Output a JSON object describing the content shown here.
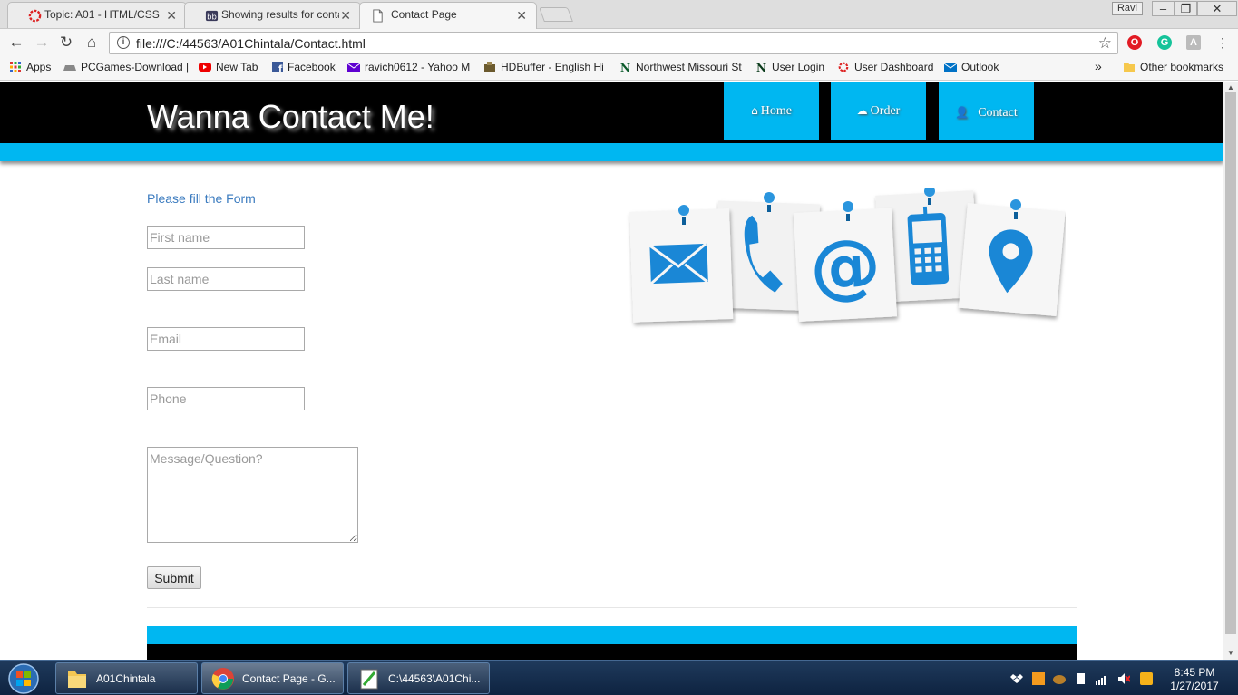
{
  "browser": {
    "tabs": [
      {
        "title": "Topic: A01 - HTML/CSS",
        "icon": "red-ring-icon"
      },
      {
        "title": "Showing results for conta",
        "icon": "blackboard-icon"
      },
      {
        "title": "Contact Page",
        "icon": "document-icon"
      }
    ],
    "profile_label": "Ravi",
    "url": "file:///C:/44563/A01Chintala/Contact.html",
    "bookmarks": [
      {
        "label": "Apps",
        "icon": "apps-grid-icon"
      },
      {
        "label": "PCGames-Download |",
        "icon": "gamepad-icon"
      },
      {
        "label": "New Tab",
        "icon": "youtube-icon"
      },
      {
        "label": "Facebook",
        "icon": "facebook-icon"
      },
      {
        "label": "ravich0612 - Yahoo M",
        "icon": "yahoo-mail-icon"
      },
      {
        "label": "HDBuffer - English Hi",
        "icon": "hdbuffer-icon"
      },
      {
        "label": "Northwest Missouri St",
        "icon": "northwest-n-icon"
      },
      {
        "label": "User Login",
        "icon": "northwest-n-icon"
      },
      {
        "label": "User Dashboard",
        "icon": "red-ring-icon"
      },
      {
        "label": "Outlook",
        "icon": "outlook-icon"
      }
    ],
    "more_bookmarks": "»",
    "other_bookmarks": "Other bookmarks"
  },
  "page": {
    "title": "Wanna Contact Me!",
    "nav": [
      {
        "label": "Home",
        "icon": "home-icon"
      },
      {
        "label": "Order",
        "icon": "cloud-icon"
      },
      {
        "label": "Contact",
        "icon": "user-icon"
      }
    ],
    "form_heading": "Please fill the Form",
    "fields": {
      "first_name": "First name",
      "last_name": "Last name",
      "email": "Email",
      "phone": "Phone",
      "message": "Message/Question?"
    },
    "submit_label": "Submit",
    "colors": {
      "accent": "#00b7f1",
      "header_bg": "#000000",
      "heading": "#3b7bbf",
      "icon_blue": "#1a87d6"
    }
  },
  "taskbar": {
    "items": [
      {
        "label": "A01Chintala",
        "icon": "folder-icon"
      },
      {
        "label": "Contact Page - G...",
        "icon": "chrome-icon"
      },
      {
        "label": "C:\\44563\\A01Chi...",
        "icon": "notepad-plus-icon"
      }
    ],
    "time": "8:45 PM",
    "date": "1/27/2017"
  }
}
